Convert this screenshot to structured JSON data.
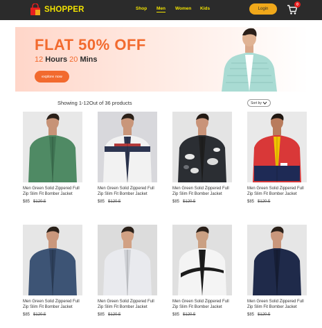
{
  "header": {
    "logo_text": "SHOPPER",
    "nav": [
      {
        "label": "Shop",
        "active": false
      },
      {
        "label": "Men",
        "active": true
      },
      {
        "label": "Women",
        "active": false
      },
      {
        "label": "Kids",
        "active": false
      }
    ],
    "login_label": "Login",
    "cart_count": "0"
  },
  "banner": {
    "title": "FLAT 50% OFF",
    "hours_num": "12",
    "hours_label": " Hours ",
    "mins_num": "20",
    "mins_label": " Mins",
    "cta": "explore now"
  },
  "listing": {
    "showing_text": "Showing 1-12Out of 36 products",
    "sort_label": "Sort by"
  },
  "products": [
    {
      "name": "Men Green Solid Zippered Full Zip Slim Fit Bomber Jacket",
      "price": "$85",
      "old_price": "$120.5",
      "style": "green"
    },
    {
      "name": "Men Green Solid Zippered Full Zip Slim Fit Bomber Jacket",
      "price": "$85",
      "old_price": "$120.5",
      "style": "white-navy"
    },
    {
      "name": "Men Green Solid Zippered Full Zip Slim Fit Bomber Jacket",
      "price": "$85",
      "old_price": "$120.5",
      "style": "camo"
    },
    {
      "name": "Men Green Solid Zippered Full Zip Slim Fit Bomber Jacket",
      "price": "$85",
      "old_price": "$120.5",
      "style": "red-colorblock"
    },
    {
      "name": "Men Green Solid Zippered Full Zip Slim Fit Bomber Jacket",
      "price": "$85",
      "old_price": "$120.5",
      "style": "denim"
    },
    {
      "name": "Men Green Solid Zippered Full Zip Slim Fit Bomber Jacket",
      "price": "$85",
      "old_price": "$120.5",
      "style": "light-grey"
    },
    {
      "name": "Men Green Solid Zippered Full Zip Slim Fit Bomber Jacket",
      "price": "$85",
      "old_price": "$120.5",
      "style": "white-black"
    },
    {
      "name": "Men Green Solid Zippered Full Zip Slim Fit Bomber Jacket",
      "price": "$85",
      "old_price": "$120.5",
      "style": "navy"
    }
  ],
  "colors": {
    "navbar": "#2b2b2b",
    "nav_text": "#f2e300",
    "login": "#f0a81a",
    "accent": "#f26a2e",
    "badge": "#e81f1f"
  }
}
